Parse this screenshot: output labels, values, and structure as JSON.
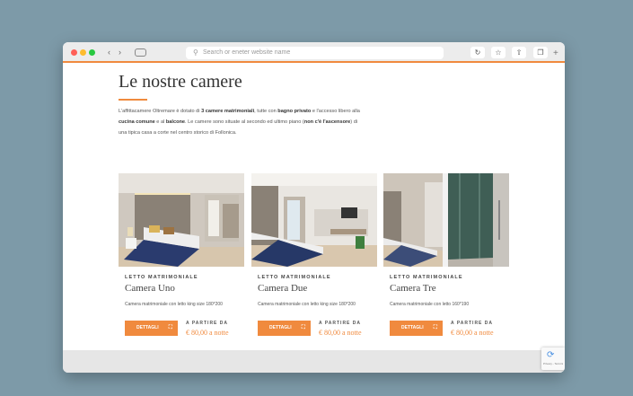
{
  "browser": {
    "address_placeholder": "Search or eneter website name",
    "icons": {
      "back": "‹",
      "forward": "›",
      "search": "⚲",
      "reload": "↻",
      "bookmark": "☆",
      "share": "⇧",
      "tabs": "❐",
      "new_tab": "+"
    }
  },
  "page": {
    "title": "Le nostre camere",
    "accent_color": "#f08a3e",
    "intro": {
      "p1": "L'affittacamere Oltremare è dotato di ",
      "b1": "3 camere matrimoniali",
      "p2": ", tutte con ",
      "b2": "bagno privato",
      "p3": " e l'accesso libero alla ",
      "b3": "cucina comune",
      "p4": " e al ",
      "b4": "balcone",
      "p5": ". Le camere sono situate al secondo ed ultimo piano (",
      "b5": "non c'è l'ascensore",
      "p6": ") di una tipica casa a corte nel centro storico di Follonica."
    }
  },
  "cards": [
    {
      "category": "LETTO MATRIMONIALE",
      "name": "Camera Uno",
      "description": "Camera matrimoniale con letto king size 180*200",
      "button": "DETTAGLI",
      "from": "A PARTIRE DA",
      "price": "€ 80,00 a notte"
    },
    {
      "category": "LETTO MATRIMONIALE",
      "name": "Camera Due",
      "description": "Camera matrimoniale con letto king size 180*200",
      "button": "DETTAGLI",
      "from": "A PARTIRE DA",
      "price": "€ 80,00 a notte"
    },
    {
      "category": "LETTO MATRIMONIALE",
      "name": "Camera Tre",
      "description": "Camera matrimoniale con letto 160*190",
      "button": "DETTAGLI",
      "from": "A PARTIRE DA",
      "price": "€ 80,00 a notte"
    }
  ],
  "recaptcha": {
    "label": "Privacy - Termini"
  }
}
